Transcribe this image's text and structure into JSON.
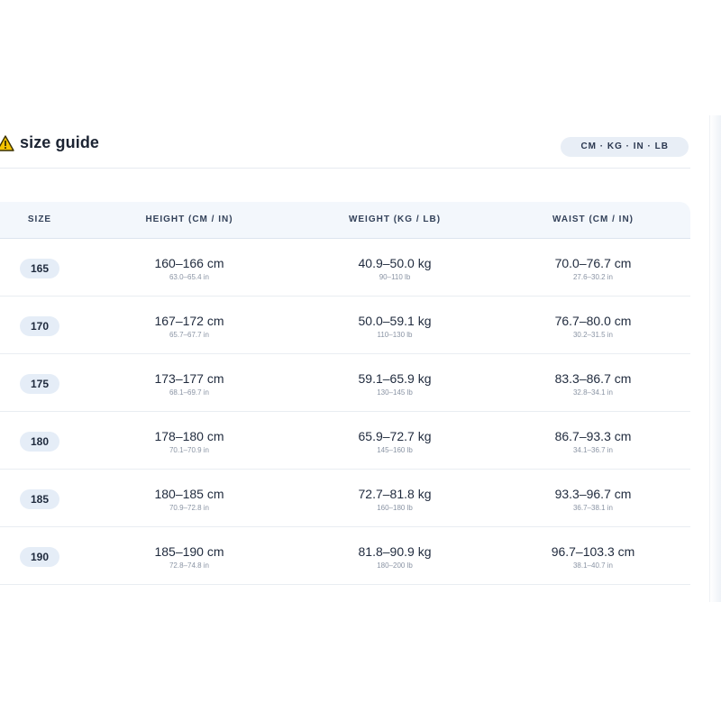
{
  "title": "size guide",
  "units_label": "CM · KG · IN · LB",
  "columns": {
    "size": "SIZE",
    "height": "HEIGHT (CM / IN)",
    "weight": "WEIGHT (KG / LB)",
    "waist": "WAIST (CM / IN)"
  },
  "rows": [
    {
      "size": "165",
      "height": "160–166 cm",
      "height_in": "63.0–65.4 in",
      "weight": "40.9–50.0 kg",
      "weight_lb": "90–110 lb",
      "waist": "70.0–76.7 cm",
      "waist_in": "27.6–30.2 in"
    },
    {
      "size": "170",
      "height": "167–172 cm",
      "height_in": "65.7–67.7 in",
      "weight": "50.0–59.1 kg",
      "weight_lb": "110–130 lb",
      "waist": "76.7–80.0 cm",
      "waist_in": "30.2–31.5 in"
    },
    {
      "size": "175",
      "height": "173–177 cm",
      "height_in": "68.1–69.7 in",
      "weight": "59.1–65.9 kg",
      "weight_lb": "130–145 lb",
      "waist": "83.3–86.7 cm",
      "waist_in": "32.8–34.1 in"
    },
    {
      "size": "180",
      "height": "178–180 cm",
      "height_in": "70.1–70.9 in",
      "weight": "65.9–72.7 kg",
      "weight_lb": "145–160 lb",
      "waist": "86.7–93.3 cm",
      "waist_in": "34.1–36.7 in"
    },
    {
      "size": "185",
      "height": "180–185 cm",
      "height_in": "70.9–72.8 in",
      "weight": "72.7–81.8 kg",
      "weight_lb": "160–180 lb",
      "waist": "93.3–96.7 cm",
      "waist_in": "36.7–38.1 in"
    },
    {
      "size": "190",
      "height": "185–190 cm",
      "height_in": "72.8–74.8 in",
      "weight": "81.8–90.9 kg",
      "weight_lb": "180–200 lb",
      "waist": "96.7–103.3 cm",
      "waist_in": "38.1–40.7 in"
    }
  ],
  "icons": {
    "title_icon": "warning-triangle-icon"
  },
  "colors": {
    "accent_icon": "#f5c400",
    "pill_bg": "#e5edf7",
    "header_bg": "#f3f7fc"
  }
}
